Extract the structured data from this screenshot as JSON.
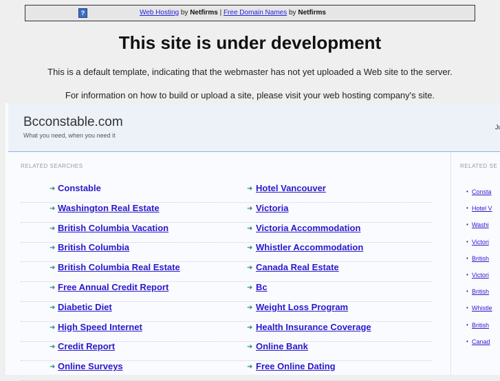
{
  "banner": {
    "link1": "Web Hosting",
    "by1": "by",
    "brand1": "Netfirms",
    "sep": "|",
    "link2": "Free Domain Names",
    "by2": "by",
    "brand2": "Netfirms",
    "help_icon": "?"
  },
  "title": "This site is under development",
  "para1": "This is a default template, indicating that the webmaster has not yet uploaded a Web site to the server.",
  "para2": "For information on how to build or upload a site, please visit your web hosting company's site.",
  "site": {
    "name": "Bcconstable.com",
    "tagline": "What you need, when you need it",
    "date_fragment": "Ju"
  },
  "related_label": "RELATED SEARCHES",
  "related_left": [
    "Constable",
    "Washington Real Estate",
    "British Columbia Vacation",
    "British Columbia",
    "British Columbia Real Estate",
    "Free Annual Credit Report",
    "Diabetic Diet",
    "High Speed Internet",
    "Credit Report",
    "Online Surveys"
  ],
  "related_right": [
    "Hotel Vancouver",
    "Victoria",
    "Victoria Accommodation",
    "Whistler Accommodation",
    "Canada Real Estate",
    "Bc",
    "Weight Loss Program",
    "Health Insurance Coverage",
    "Online Bank",
    "Free Online Dating"
  ],
  "sidebar_label": "RELATED SE",
  "sidebar_items": [
    "Consta",
    "Hotel V",
    "Washi",
    "Victori",
    "British",
    "Victori",
    "British",
    "Whistle",
    "British",
    "Canad"
  ],
  "colors": {
    "link": "#2a18cc",
    "arrow": "#2a8a7a",
    "header_line": "#8fb0e6"
  }
}
